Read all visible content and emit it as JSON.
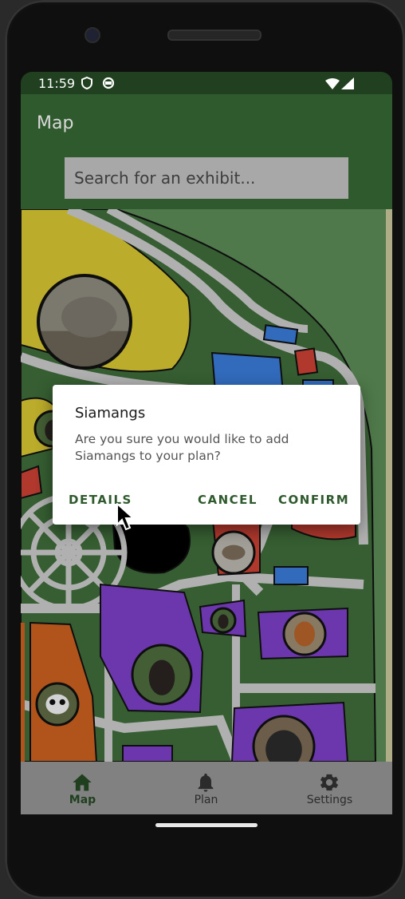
{
  "status": {
    "time": "11:59"
  },
  "appbar": {
    "title": "Map"
  },
  "search": {
    "placeholder": "Search for an exhibit..."
  },
  "dialog": {
    "title": "Siamangs",
    "message": "Are you sure you would like to add Siamangs to your plan?",
    "details_label": "DETAILS",
    "cancel_label": "CANCEL",
    "confirm_label": "CONFIRM"
  },
  "nav": [
    {
      "label": "Map",
      "icon": "home-icon",
      "active": true
    },
    {
      "label": "Plan",
      "icon": "bell-icon",
      "active": false
    },
    {
      "label": "Settings",
      "icon": "gear-icon",
      "active": false
    }
  ],
  "map": {
    "exhibits": [
      "elephant-exhibit",
      "siamang-exhibit",
      "wolf-exhibit",
      "orangutan-exhibit",
      "chimpanzee-exhibit",
      "gorilla-exhibit",
      "panda-exhibit",
      "small-exhibit"
    ]
  },
  "colors": {
    "appbar": "#2f5a2d",
    "accent": "#2f5a2d",
    "map_grass": "#3e6b3a",
    "path": "#c9c9c9",
    "yellow_zone": "#d6c431",
    "purple_zone": "#7b3fc4",
    "orange_zone": "#c9601f",
    "blue_zone": "#3a7ad6",
    "red_zone": "#c94034"
  }
}
